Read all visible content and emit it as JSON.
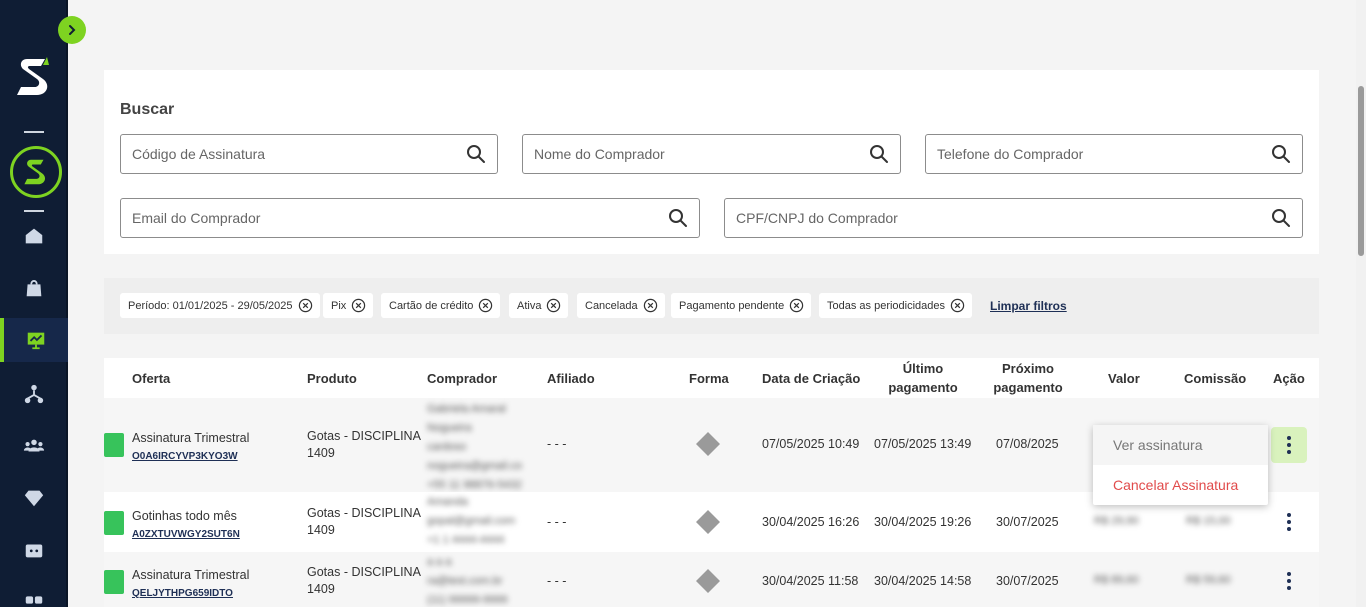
{
  "sidebar": {
    "toggle_icon": "chevron-right-icon",
    "accent_color": "#7ed321",
    "items": [
      {
        "name": "home",
        "icon": "home-icon"
      },
      {
        "name": "products",
        "icon": "shopping-bag-icon"
      },
      {
        "name": "subscriptions",
        "icon": "presentation-chart-icon"
      },
      {
        "name": "affiliates",
        "icon": "network-icon"
      },
      {
        "name": "users",
        "icon": "users-icon"
      },
      {
        "name": "diamond",
        "icon": "diamond-icon"
      },
      {
        "name": "wallet",
        "icon": "wallet-icon"
      },
      {
        "name": "apps",
        "icon": "grid-icon"
      }
    ]
  },
  "search": {
    "title": "Buscar",
    "fields": {
      "code": "Código de Assinatura",
      "buyer_name": "Nome do Comprador",
      "buyer_phone": "Telefone do Comprador",
      "buyer_email": "Email do Comprador",
      "buyer_doc": "CPF/CNPJ do Comprador"
    }
  },
  "filters": {
    "chips": [
      "Período: 01/01/2025 - 29/05/2025",
      "Pix",
      "Cartão de crédito",
      "Ativa",
      "Cancelada",
      "Pagamento pendente",
      "Todas as periodicidades"
    ],
    "clear_label": "Limpar filtros"
  },
  "table": {
    "headers": {
      "offer": "Oferta",
      "product": "Produto",
      "buyer": "Comprador",
      "affiliate": "Afiliado",
      "method": "Forma",
      "created": "Data de Criação",
      "last_payment_1": "Último",
      "last_payment_2": "pagamento",
      "next_payment_1": "Próximo",
      "next_payment_2": "pagamento",
      "value": "Valor",
      "commission": "Comissão",
      "action": "Ação"
    },
    "status_color": "#37c35b",
    "rows": [
      {
        "offer_name": "Assinatura Trimestral",
        "offer_code": "O0A6IRCYVP3KYO3W",
        "product_1": "Gotas - DISCIPLINA",
        "product_2": "1409",
        "buyer_blur": [
          "Gabriela Amaral",
          "Nogueira",
          "cardoso",
          "nogueira@gmail.co",
          "+55 11 98876-5432"
        ],
        "affiliate": "- - -",
        "method_icon": "pix-icon",
        "created": "07/05/2025 10:49",
        "last_payment": "07/05/2025 13:49",
        "next_payment": "07/08/2025",
        "value_blur": "",
        "commission_blur": ""
      },
      {
        "offer_name": "Gotinhas todo mês",
        "offer_code": "A0ZXTUVWGY2SUT6N",
        "product_1": "Gotas - DISCIPLINA",
        "product_2": "1409",
        "buyer_blur": [
          "Amanda",
          "gopal@gmail.com",
          "+1 1 4444-4444"
        ],
        "affiliate": "- - -",
        "method_icon": "pix-icon",
        "created": "30/04/2025 16:26",
        "last_payment": "30/04/2025 19:26",
        "next_payment": "30/07/2025",
        "value_blur": "R$ 29,90",
        "commission_blur": "R$ 15,00"
      },
      {
        "offer_name": "Assinatura Trimestral",
        "offer_code": "QELJYTHPG659IDTO",
        "product_1": "Gotas - DISCIPLINA",
        "product_2": "1409",
        "buyer_blur": [
          "a a a",
          "ra@test.com.br",
          "(11) 99999-9999"
        ],
        "affiliate": "- - -",
        "method_icon": "pix-icon",
        "created": "30/04/2025 11:58",
        "last_payment": "30/04/2025 14:58",
        "next_payment": "30/07/2025",
        "value_blur": "R$ 89,60",
        "commission_blur": "R$ 59,60"
      }
    ]
  },
  "menu": {
    "view": "Ver assinatura",
    "cancel": "Cancelar Assinatura",
    "cancel_color": "#e14b4b"
  }
}
